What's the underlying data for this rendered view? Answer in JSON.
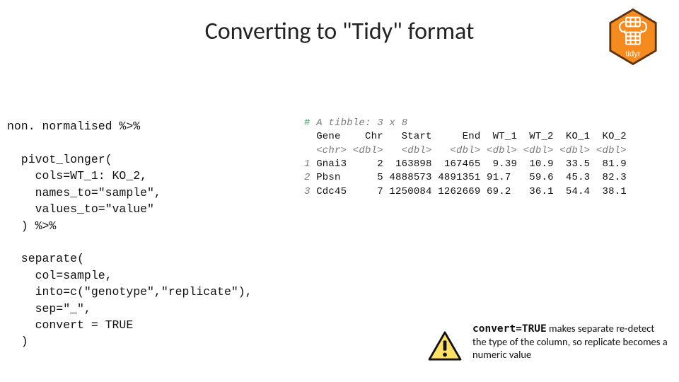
{
  "title": "Converting to \"Tidy\" format",
  "logo": {
    "name": "tidyr"
  },
  "code": {
    "l1": "non. normalised %>%",
    "l2": "",
    "l3": "  pivot_longer(",
    "l4": "    cols=WT_1: KO_2,",
    "l5": "    names_to=\"sample\",",
    "l6": "    values_to=\"value\"",
    "l7": "  ) %>%",
    "l8": "",
    "l9": "  separate(",
    "l10": "    col=sample,",
    "l11": "    into=c(\"genotype\",\"replicate\"),",
    "l12": "    sep=\"_\",",
    "l13": "    convert = TRUE",
    "l14": "  )"
  },
  "tibble": {
    "comment_hash": "#",
    "header": " A tibble: 3 x 8",
    "cols": "  Gene    Chr   Start     End  WT_1  WT_2  KO_1  KO_2",
    "types": "  <chr> <dbl>   <dbl>   <dbl> <dbl> <dbl> <dbl> <dbl>",
    "row1n": "1",
    "row1": " Gnai3     2  163898  167465  9.39  10.9  33.5  81.9",
    "row2n": "2",
    "row2": " Pbsn      5 4888573 4891351 91.7   59.6  45.3  82.3",
    "row3n": "3",
    "row3": " Cdc45     7 1250084 1262669 69.2   36.1  54.4  38.1"
  },
  "note": {
    "bold": "convert=TRUE",
    "rest": " makes separate re-detect the type of the column, so replicate becomes a numeric value"
  }
}
